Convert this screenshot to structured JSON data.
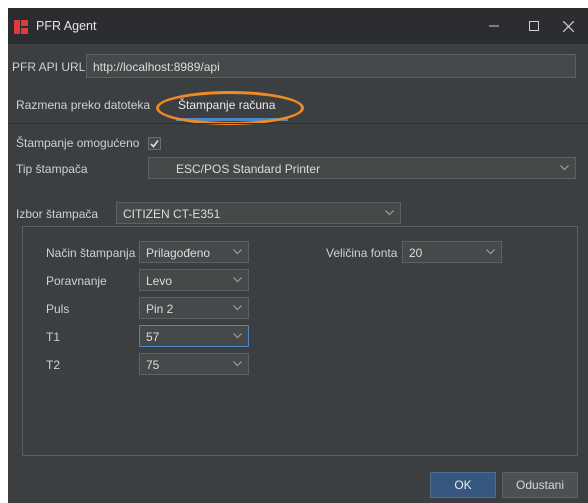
{
  "window": {
    "title": "PFR Agent",
    "icon": "pfr-logo-icon",
    "controls": [
      "minimize-icon",
      "maximize-icon",
      "close-icon"
    ]
  },
  "api": {
    "label": "PFR API URL",
    "value": "http://localhost:8989/api"
  },
  "tabs": [
    {
      "label": "Razmena preko datoteka",
      "active": false
    },
    {
      "label": "Štampanje računa",
      "active": true
    }
  ],
  "printing": {
    "enabled_label": "Štampanje omogućeno",
    "enabled": true,
    "printer_type_label": "Tip štampača",
    "printer_type_value": "ESC/POS Standard Printer",
    "printer_select_label": "Izbor štampača",
    "printer_select_value": "CITIZEN CT-E351"
  },
  "settings": {
    "mode_label": "Način štampanja",
    "mode_value": "Prilagođeno",
    "align_label": "Poravnanje",
    "align_value": "Levo",
    "pulse_label": "Puls",
    "pulse_value": "Pin 2",
    "t1_label": "T1",
    "t1_value": "57",
    "t2_label": "T2",
    "t2_value": "75",
    "font_size_label": "Veličina fonta",
    "font_size_value": "20"
  },
  "buttons": {
    "ok": "OK",
    "cancel": "Odustani"
  },
  "colors": {
    "background": "#3c3f41",
    "titlebar": "#2b2d30",
    "accent": "#4a88c7",
    "highlight": "#f08a24",
    "logo": "#e03a3a"
  }
}
